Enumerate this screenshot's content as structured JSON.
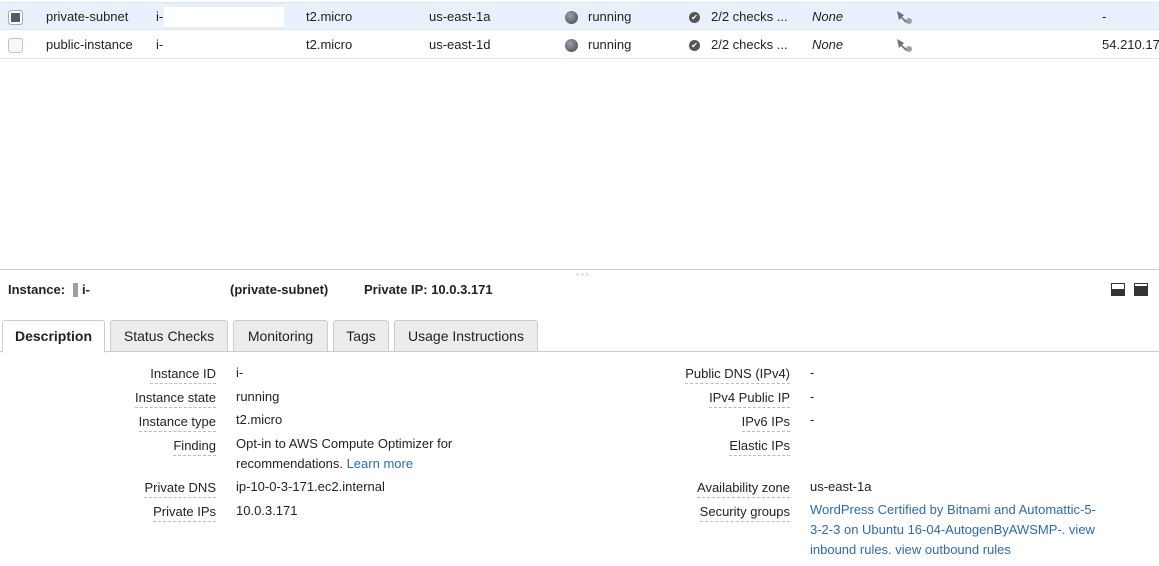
{
  "instances": [
    {
      "name": "private-subnet",
      "id": "i-",
      "type": "t2.micro",
      "az": "us-east-1a",
      "state": "running",
      "checks": "2/2 checks ...",
      "alarm": "None",
      "public_ip": "-",
      "selected": true
    },
    {
      "name": "public-instance",
      "id": "i-",
      "type": "t2.micro",
      "az": "us-east-1d",
      "state": "running",
      "checks": "2/2 checks ...",
      "alarm": "None",
      "public_ip": "54.210.17",
      "selected": false
    }
  ],
  "splitter": {
    "grip": "▫▫▫"
  },
  "header": {
    "label": "Instance:",
    "id": "i-",
    "name": "(private-subnet)",
    "private_ip": "Private IP: 10.0.3.171"
  },
  "tabs": [
    "Description",
    "Status Checks",
    "Monitoring",
    "Tags",
    "Usage Instructions"
  ],
  "description": {
    "left": [
      {
        "label": "Instance ID",
        "value": "i-"
      },
      {
        "label": "Instance state",
        "value": "running"
      },
      {
        "label": "Instance type",
        "value": "t2.micro"
      },
      {
        "label": "Finding",
        "value_line1": "Opt-in to AWS Compute Optimizer for",
        "value_line2": "recommendations.",
        "link": "Learn more"
      },
      {
        "label": "Private DNS",
        "value": "ip-10-0-3-171.ec2.internal"
      },
      {
        "label": "Private IPs",
        "value": "10.0.3.171"
      }
    ],
    "right": [
      {
        "label": "Public DNS (IPv4)",
        "value": "-"
      },
      {
        "label": "IPv4 Public IP",
        "value": "-"
      },
      {
        "label": "IPv6 IPs",
        "value": "-"
      },
      {
        "label": "Elastic IPs",
        "value": ""
      },
      {
        "label": "Availability zone",
        "value": "us-east-1a"
      },
      {
        "label": "Security groups",
        "line1": "WordPress Certified by Bitnami and Automattic-5-",
        "line2": "3-2-3 on Ubuntu 16-04-AutogenByAWSMP-. view",
        "line3": "inbound rules. view outbound rules"
      }
    ]
  },
  "colors": {
    "selected_row": "#e8f0fb",
    "link": "#2f6aa8",
    "tab_inactive": "#ececec"
  }
}
